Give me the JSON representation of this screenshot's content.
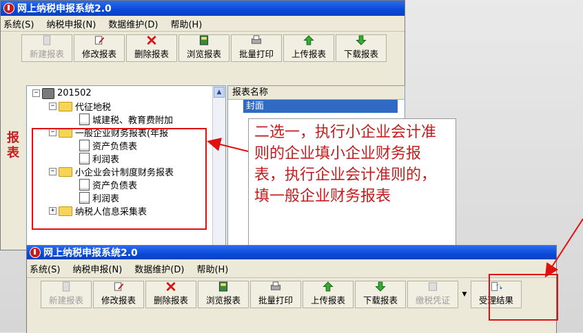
{
  "app": {
    "title": "网上纳税申报系统2.0"
  },
  "menu": [
    "系统(S)",
    "纳税申报(N)",
    "数据维护(D)",
    "帮助(H)"
  ],
  "toolbar_top": [
    "新建报表",
    "修改报表",
    "删除报表",
    "浏览报表",
    "批量打印",
    "上传报表",
    "下载报表"
  ],
  "toolbar_bottom": [
    "新建报表",
    "修改报表",
    "删除报表",
    "浏览报表",
    "批量打印",
    "上传报表",
    "下载报表",
    "缴税凭证",
    "受理结果"
  ],
  "side_label": [
    "报",
    "表"
  ],
  "tree": {
    "root": "201502",
    "items": [
      {
        "label": "代征地税",
        "level": 1,
        "type": "folder"
      },
      {
        "label": "城建税、教育费附加",
        "level": 2,
        "type": "doc"
      },
      {
        "label": "一般企业财务报表(年报",
        "level": 1,
        "type": "folder"
      },
      {
        "label": "资产负债表",
        "level": 2,
        "type": "doc"
      },
      {
        "label": "利润表",
        "level": 2,
        "type": "doc"
      },
      {
        "label": "小企业会计制度财务报表",
        "level": 1,
        "type": "folder"
      },
      {
        "label": "资产负债表",
        "level": 2,
        "type": "doc"
      },
      {
        "label": "利润表",
        "level": 2,
        "type": "doc"
      },
      {
        "label": "纳税人信息采集表",
        "level": 1,
        "type": "folder"
      }
    ]
  },
  "list": {
    "header": "报表名称",
    "selected": "封面"
  },
  "callout": "二选一，执行小企业会计准则的企业填小企业财务报表，执行企业会计准则的，填一般企业财务报表",
  "bottom_tree_root": "201502",
  "bottom_list_header": "报表名称",
  "colors": {
    "accent": "#e01010",
    "titlebar": "#0a4ad8",
    "selection": "#316ac5"
  }
}
